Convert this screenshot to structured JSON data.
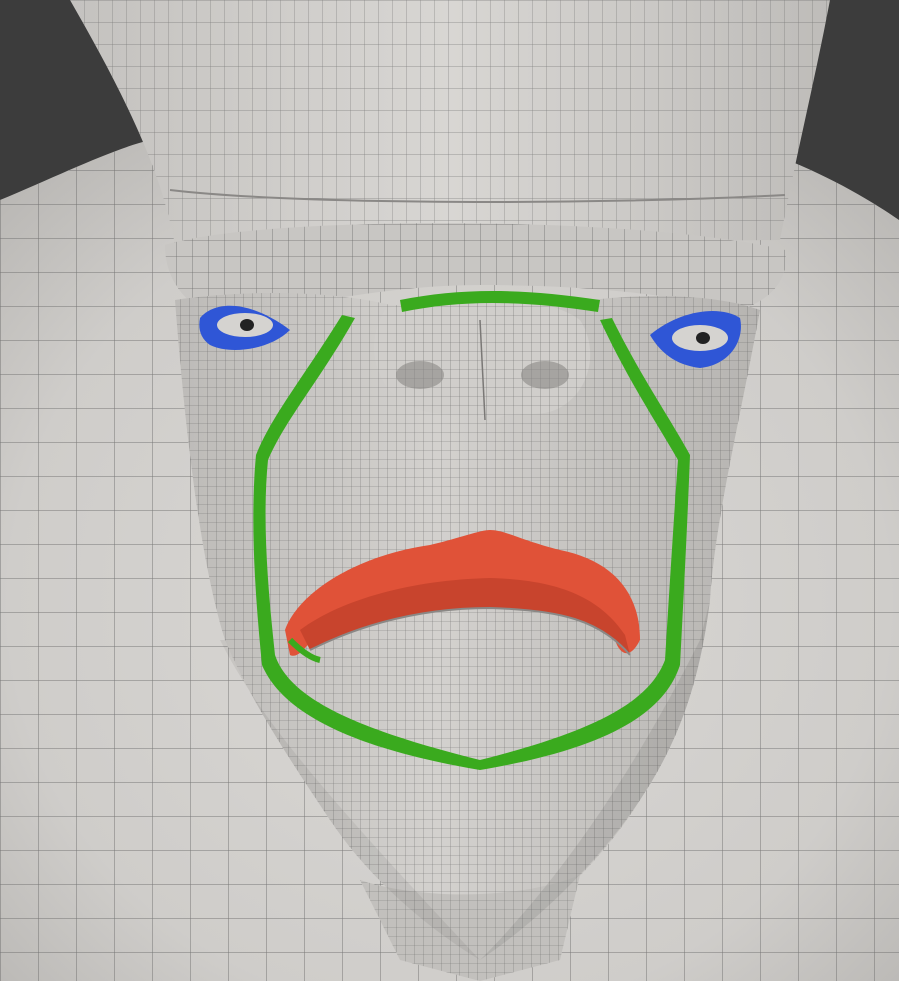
{
  "scene": {
    "background_color": "#3c3c3c",
    "mesh_base_color": "#cfcdca",
    "mesh_shade_color": "#b5b3b0",
    "mesh_wire_color": "#4a4a4a",
    "mesh_fine_wire_color": "#6a6a6a"
  },
  "edge_loops": [
    {
      "name": "eye-loop-left",
      "color": "#2f56d6"
    },
    {
      "name": "eye-loop-right",
      "color": "#2f56d6"
    },
    {
      "name": "nasolabial-mouth-loop",
      "color": "#3aaa1e"
    },
    {
      "name": "lips-loop",
      "color": "#e05238"
    }
  ]
}
